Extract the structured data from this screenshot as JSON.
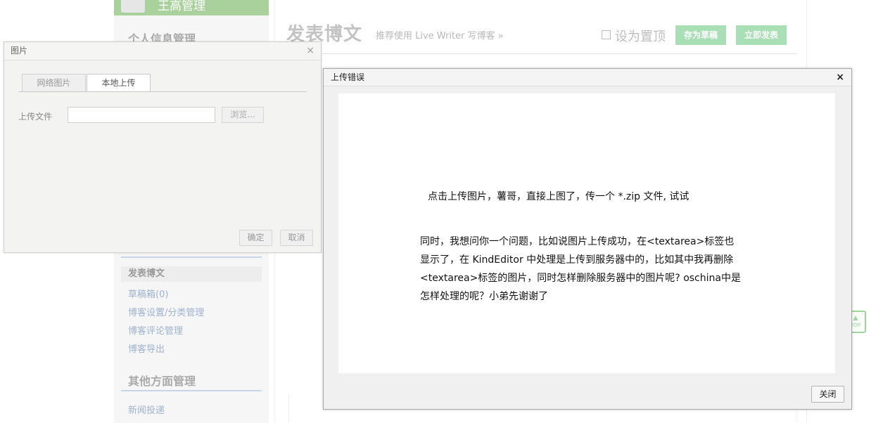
{
  "sidebar": {
    "user_name": "王高管理",
    "sections": [
      {
        "heading": "个人信息管理"
      },
      {
        "heading": "其他方面管理"
      }
    ],
    "blog_items": [
      {
        "label": "发表博文",
        "current": true
      },
      {
        "label": "草稿箱(0)"
      },
      {
        "label": "博客设置/分类管理"
      },
      {
        "label": "博客评论管理"
      },
      {
        "label": "博客导出"
      }
    ],
    "other_items": [
      {
        "label": "新闻投递"
      }
    ]
  },
  "editor": {
    "title": "发表博文",
    "subtitle": "推荐使用 Live Writer 写博客 »",
    "pin_label": "设为置顶",
    "save_draft_label": "存为草稿",
    "publish_label": "立即发表",
    "top_widget_label": "TOP"
  },
  "image_dialog": {
    "title": "图片",
    "close_glyph": "×",
    "tabs": [
      {
        "label": "网络图片",
        "active": false
      },
      {
        "label": "本地上传",
        "active": true
      }
    ],
    "upload_label": "上传文件",
    "file_value": "",
    "browse_label": "浏览...",
    "ok_label": "确定",
    "cancel_label": "取消"
  },
  "error_dialog": {
    "title": "上传错误",
    "close_glyph": "×",
    "message_line": "点击上传图片，薯哥，直接上图了，传一个 *.zip 文件, 试试",
    "paragraph_lines": [
      "同时，我想问你一个问题，比如说图片上传成功，在<textarea>标签也",
      "显示了，在 KindEditor 中处理是上传到服务器中的，比如其中我再删除",
      "<textarea>标签的图片，同时怎样删除服务器中的图片呢? oschina中是",
      "怎样处理的呢？小弟先谢谢了"
    ],
    "close_button_label": "关闭"
  }
}
